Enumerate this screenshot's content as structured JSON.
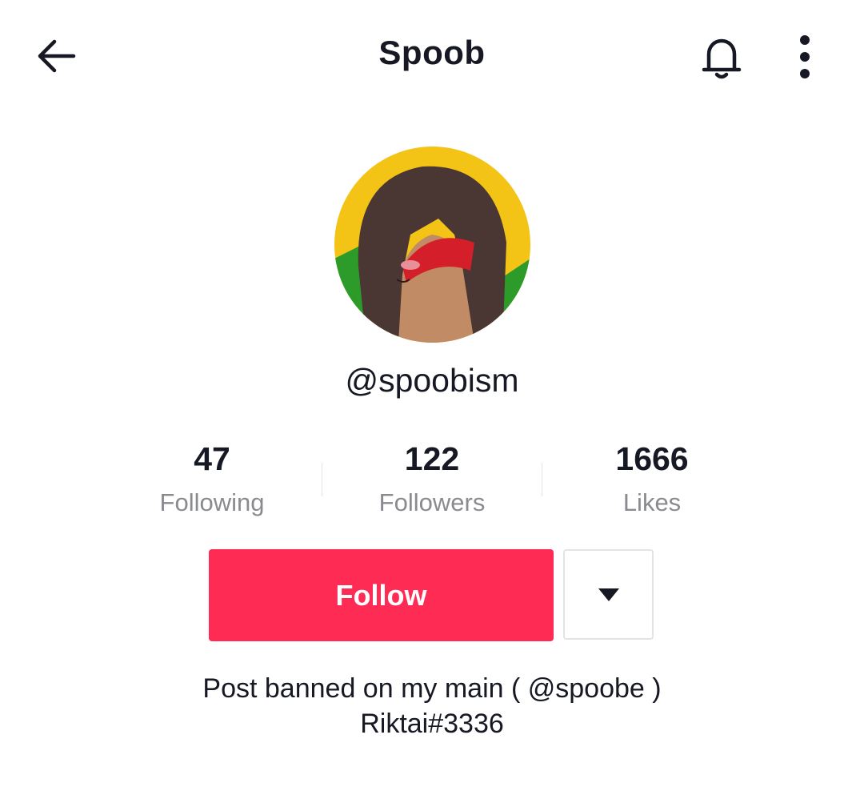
{
  "header": {
    "title": "Spoob",
    "icons": {
      "back": "back-arrow-icon",
      "bell": "bell-icon",
      "more": "more-vertical-icon"
    }
  },
  "profile": {
    "username": "@spoobism",
    "avatar": "avatar-illustration"
  },
  "stats": [
    {
      "value": "47",
      "label": "Following"
    },
    {
      "value": "122",
      "label": "Followers"
    },
    {
      "value": "1666",
      "label": "Likes"
    }
  ],
  "actions": {
    "follow_label": "Follow",
    "dropdown_icon": "caret-down-icon"
  },
  "bio": {
    "line1": "Post banned on my main ( @spoobe )",
    "line2": "Riktai#3336"
  },
  "colors": {
    "accent": "#fe2c55",
    "text": "#161823",
    "secondary_text": "#8a8b91",
    "border": "#e3e3e4"
  }
}
